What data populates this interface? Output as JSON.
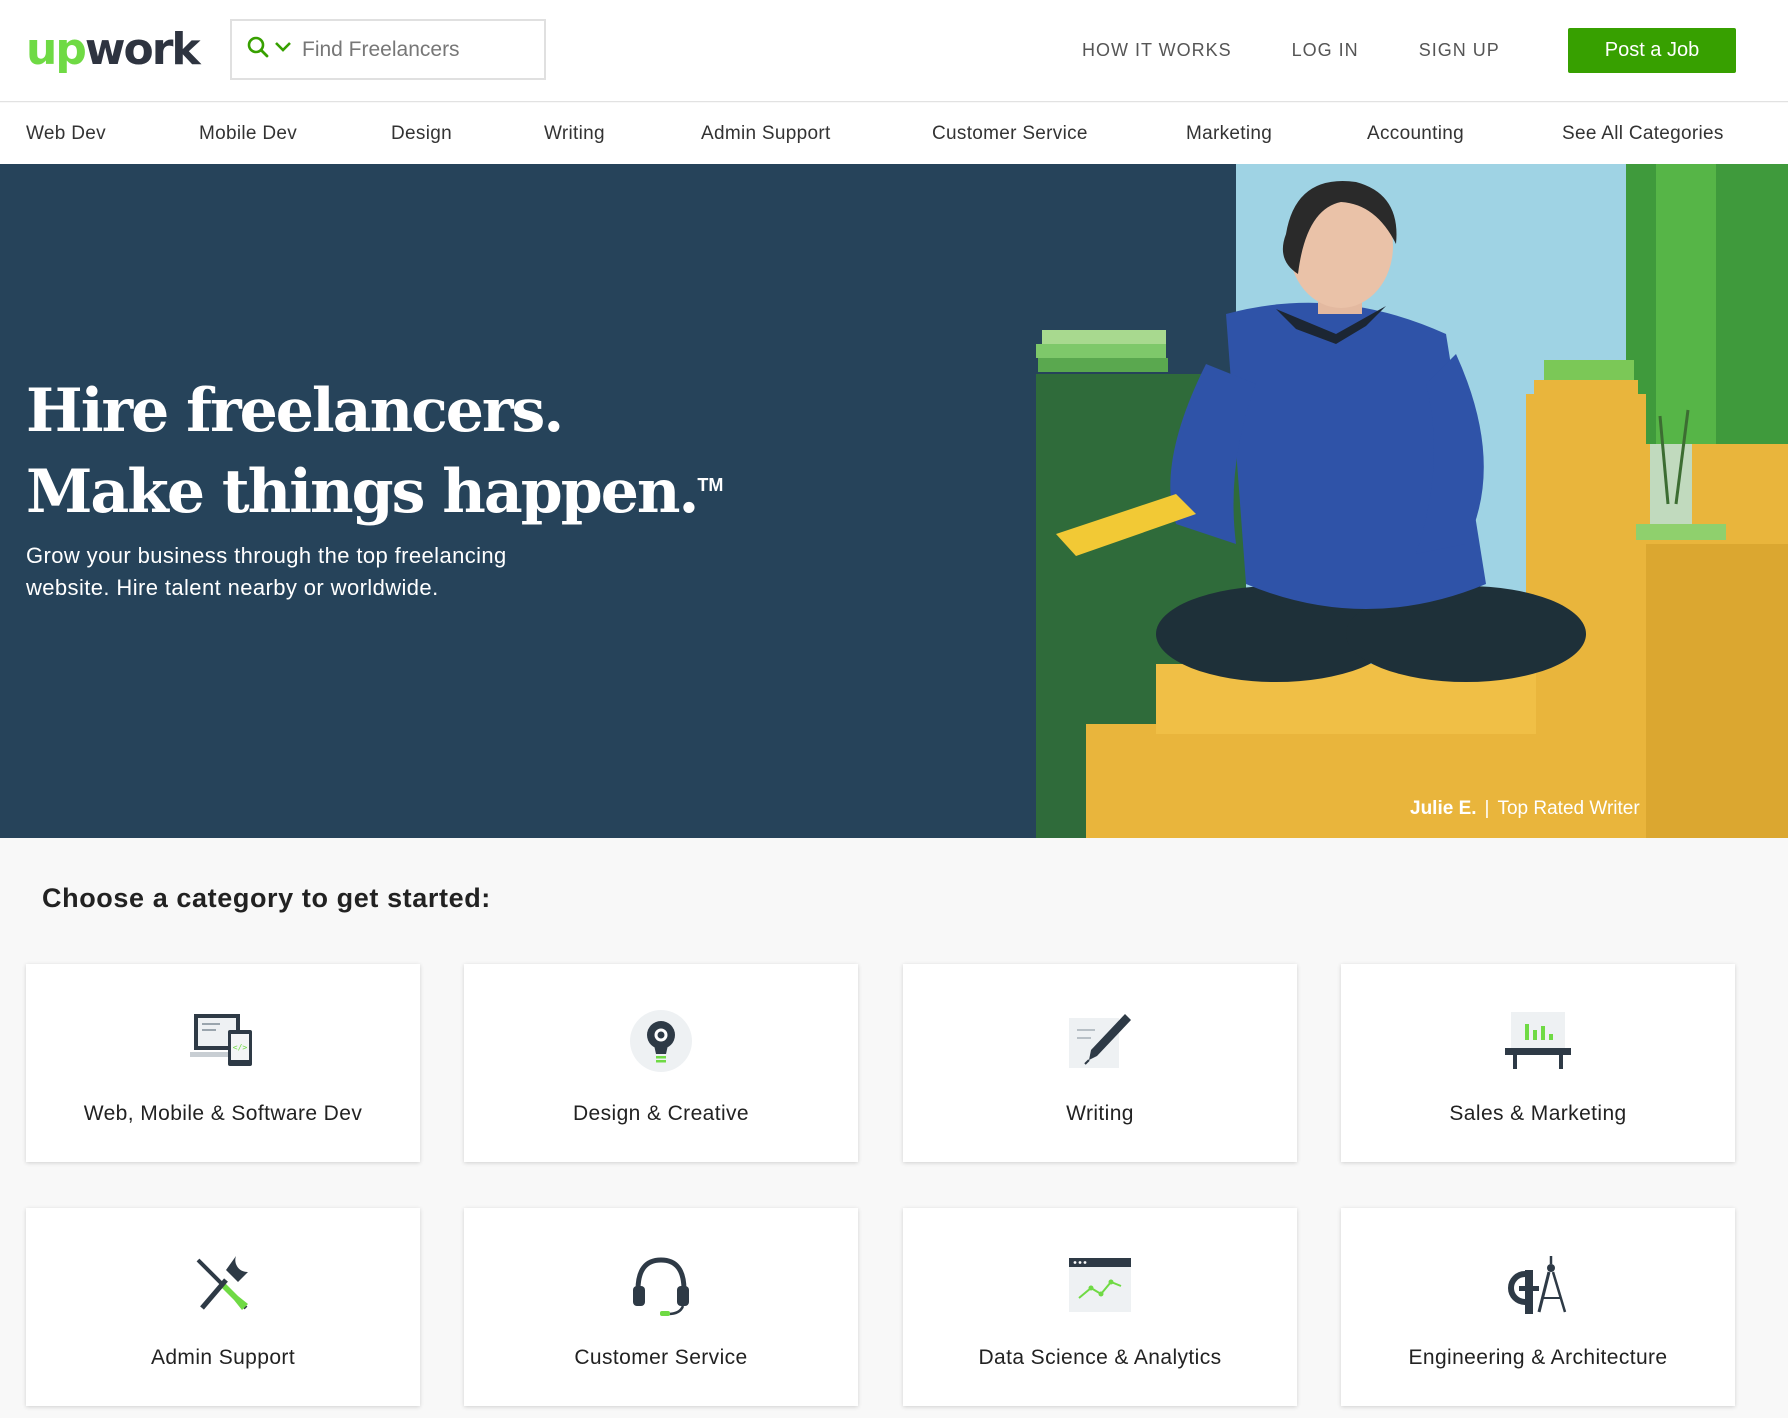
{
  "header": {
    "logo_up": "up",
    "logo_work": "work",
    "search_placeholder": "Find Freelancers",
    "links": [
      "HOW IT WORKS",
      "LOG IN",
      "SIGN UP"
    ],
    "post_job": "Post a Job"
  },
  "catnav": [
    "Web Dev",
    "Mobile Dev",
    "Design",
    "Writing",
    "Admin Support",
    "Customer Service",
    "Marketing",
    "Accounting",
    "See All Categories"
  ],
  "hero": {
    "headline_1": "Hire freelancers.",
    "headline_2": "Make things happen.",
    "tm": "TM",
    "subtitle": "Grow your business through the top freelancing website. Hire talent nearby or worldwide.",
    "caption_name": "Julie E.",
    "caption_sep": "|",
    "caption_role": "Top Rated Writer"
  },
  "categories": {
    "title": "Choose a category to get started:",
    "items": [
      {
        "label": "Web, Mobile & Software Dev",
        "icon": "devices-icon"
      },
      {
        "label": "Design & Creative",
        "icon": "lightbulb-icon"
      },
      {
        "label": "Writing",
        "icon": "pen-icon"
      },
      {
        "label": "Sales & Marketing",
        "icon": "presentation-chart-icon"
      },
      {
        "label": "Admin Support",
        "icon": "tools-icon"
      },
      {
        "label": "Customer Service",
        "icon": "headset-icon"
      },
      {
        "label": "Data Science & Analytics",
        "icon": "analytics-window-icon"
      },
      {
        "label": "Engineering & Architecture",
        "icon": "compass-ruler-icon"
      }
    ]
  },
  "colors": {
    "brand_green": "#6fda44",
    "button_green": "#37a000",
    "hero_navy": "#26435a"
  }
}
